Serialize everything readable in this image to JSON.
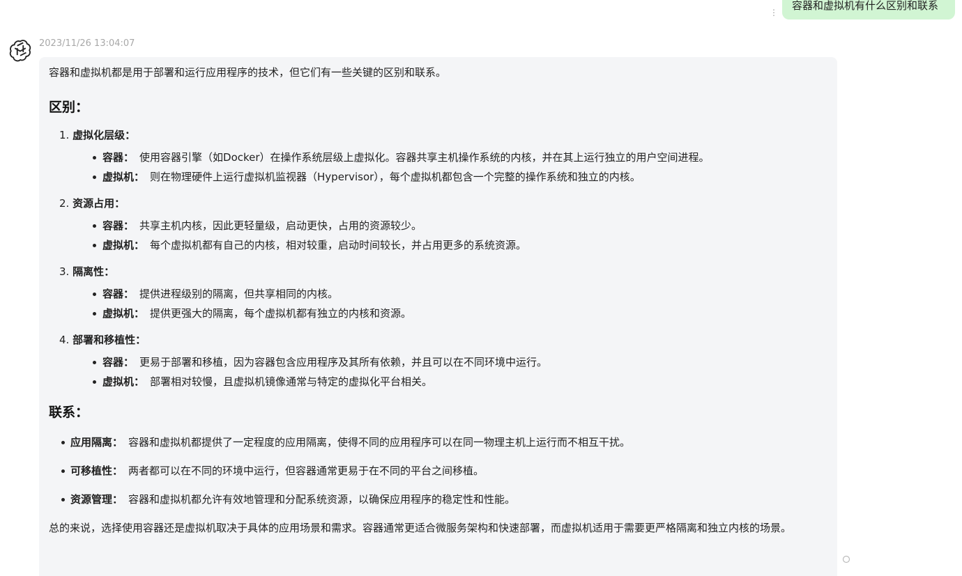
{
  "user_message": {
    "text": "容器和虚拟机有什么区别和联系",
    "menu_icon": "more-vertical-icon"
  },
  "assistant": {
    "avatar_icon": "openai-logo-icon",
    "timestamp": "2023/11/26 13:04:07",
    "intro": "容器和虚拟机都是用于部署和运行应用程序的技术，但它们有一些关键的区别和联系。",
    "diff_heading": "区别：",
    "points": [
      {
        "num": "1.",
        "title": "虚拟化层级",
        "colon": "：",
        "items": [
          {
            "label": "容器：",
            "text": "使用容器引擎（如Docker）在操作系统层级上虚拟化。容器共享主机操作系统的内核，并在其上运行独立的用户空间进程。"
          },
          {
            "label": "虚拟机：",
            "text": "则在物理硬件上运行虚拟机监视器（Hypervisor），每个虚拟机都包含一个完整的操作系统和独立的内核。"
          }
        ]
      },
      {
        "num": "2.",
        "title": "资源占用",
        "colon": "：",
        "items": [
          {
            "label": "容器：",
            "text": "共享主机内核，因此更轻量级，启动更快，占用的资源较少。"
          },
          {
            "label": "虚拟机：",
            "text": "每个虚拟机都有自己的内核，相对较重，启动时间较长，并占用更多的系统资源。"
          }
        ]
      },
      {
        "num": "3.",
        "title": "隔离性",
        "colon": "：",
        "items": [
          {
            "label": "容器：",
            "text": "提供进程级别的隔离，但共享相同的内核。"
          },
          {
            "label": "虚拟机：",
            "text": "提供更强大的隔离，每个虚拟机都有独立的内核和资源。"
          }
        ]
      },
      {
        "num": "4.",
        "title": "部署和移植性",
        "colon": "：",
        "items": [
          {
            "label": "容器：",
            "text": "更易于部署和移植，因为容器包含应用程序及其所有依赖，并且可以在不同环境中运行。"
          },
          {
            "label": "虚拟机：",
            "text": "部署相对较慢，且虚拟机镜像通常与特定的虚拟化平台相关。"
          }
        ]
      }
    ],
    "rel_heading": "联系：",
    "relations": [
      {
        "label": "应用隔离：",
        "text": "容器和虚拟机都提供了一定程度的应用隔离，使得不同的应用程序可以在同一物理主机上运行而不相互干扰。"
      },
      {
        "label": "可移植性：",
        "text": "两者都可以在不同的环境中运行，但容器通常更易于在不同的平台之间移植。"
      },
      {
        "label": "资源管理：",
        "text": "容器和虚拟机都允许有效地管理和分配系统资源，以确保应用程序的稳定性和性能。"
      }
    ],
    "summary": "总的来说，选择使用容器还是虚拟机取决于具体的应用场景和需求。容器通常更适合微服务架构和快速部署，而虚拟机适用于需要更严格隔离和独立内核的场景。",
    "side_icon": "loading-circle-icon"
  }
}
